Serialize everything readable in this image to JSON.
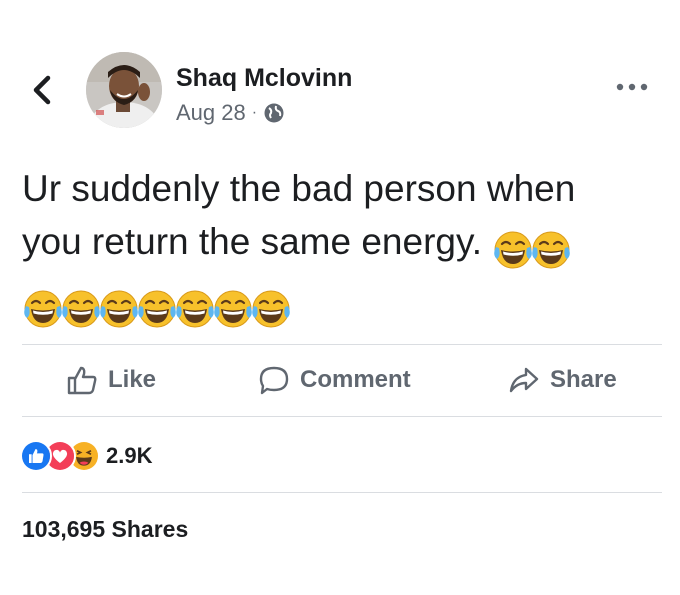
{
  "post": {
    "author": "Shaq Mclovinn",
    "date": "Aug 28",
    "separator": "·",
    "privacy_icon": "globe-icon",
    "text_line1": "Ur suddenly the bad person when",
    "text_line2": "you return the same energy.",
    "emoji_name": "face-with-tears-of-joy",
    "emoji_count": 9
  },
  "actions": {
    "like_label": "Like",
    "comment_label": "Comment",
    "share_label": "Share"
  },
  "reactions": {
    "icons": [
      "like-icon",
      "love-icon",
      "haha-icon"
    ],
    "count": "2.9K"
  },
  "shares_text": "103,695 Shares",
  "colors": {
    "text": "#1c1e21",
    "muted": "#606770",
    "divider": "#dadde1",
    "like_blue": "#1877f2",
    "love_red": "#f33e58",
    "haha_yellow": "#f7b125"
  }
}
